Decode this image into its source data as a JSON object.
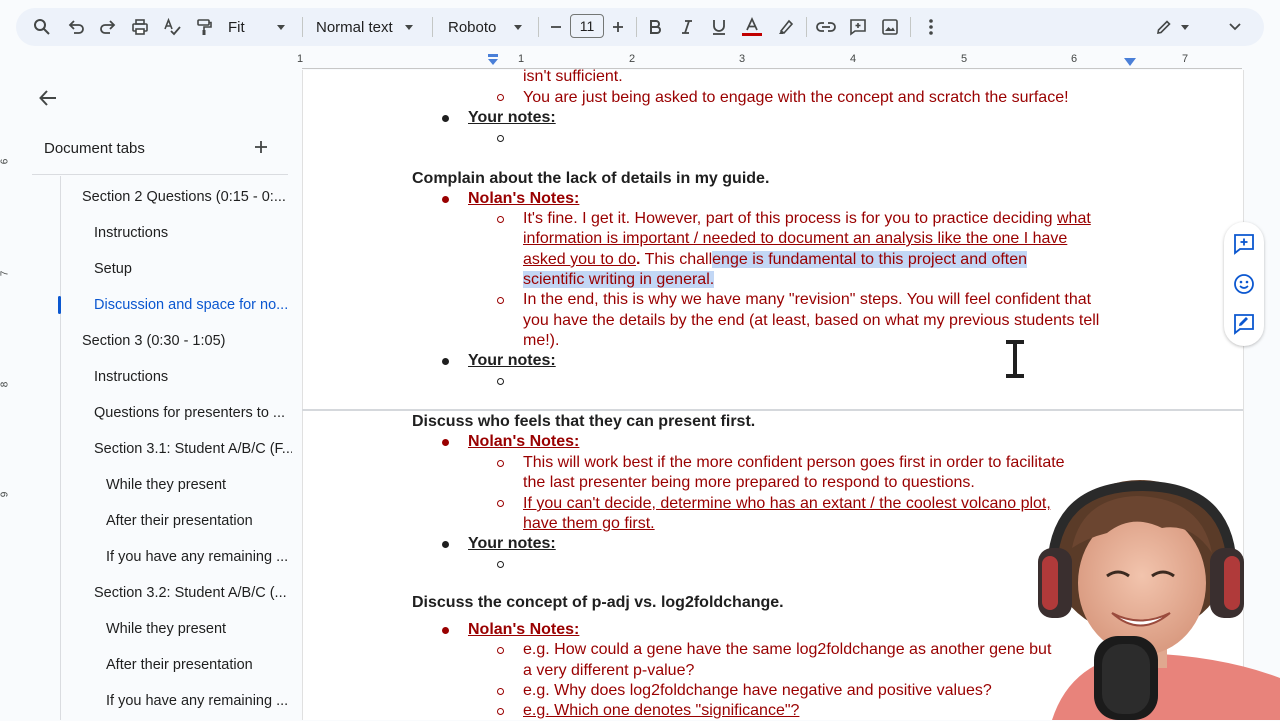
{
  "toolbar": {
    "zoom": "Fit",
    "style": "Normal text",
    "font": "Roboto",
    "font_size": "11"
  },
  "ruler": {
    "top_numbers": [
      "1",
      "1",
      "2",
      "3",
      "4",
      "5",
      "6",
      "7"
    ],
    "left_numbers": [
      "6",
      "7",
      "8",
      "9"
    ]
  },
  "sidebar": {
    "title": "Document tabs",
    "items": [
      {
        "label": "Section 2 Questions (0:15 - 0:..."
      },
      {
        "label": "Instructions"
      },
      {
        "label": "Setup"
      },
      {
        "label": "Discussion and space for no..."
      },
      {
        "label": "Section 3 (0:30 - 1:05)"
      },
      {
        "label": "Instructions"
      },
      {
        "label": "Questions for presenters to ..."
      },
      {
        "label": "Section 3.1: Student A/B/C (F..."
      },
      {
        "label": "While they present"
      },
      {
        "label": "After their presentation"
      },
      {
        "label": "If you have any remaining ..."
      },
      {
        "label": "Section 3.2: Student A/B/C (..."
      },
      {
        "label": "While they present"
      },
      {
        "label": "After their presentation"
      },
      {
        "label": "If you have any remaining ..."
      }
    ]
  },
  "doc": {
    "l01": "isn't sufficient.",
    "l02": "You are just being asked to engage with the concept and scratch the surface!",
    "your_notes": "Your notes:",
    "h1": "Complain about the lack of details in my guide.",
    "nolans_notes": "Nolan's Notes:",
    "a1": "It's fine. I get it. However, part of this process is for you to practice deciding",
    "a1u": "what",
    "a2": "information is important / needed to document an analysis like the one I have",
    "a3u": "asked you to do",
    "a3b": ".",
    "a3c": " This chall",
    "a3h": "enge is fundamental to this project and often",
    "a4h": "scientific writing in general.",
    "b1": "In the end, this is why we have many \"revision\" steps. You will feel confident that",
    "b2": "you have the details by the end (at least, based on what my previous students tell",
    "b3": "me!).",
    "h2": "Discuss who feels that they can present first.",
    "c1": "This will work best if the more confident person goes first in order to facilitate",
    "c2": "the last presenter being more prepared to respond to questions.",
    "d1": "If you can't decide, determine who has an extant / the coolest volcano plot,",
    "d2": "have them go first.",
    "h3": "Discuss the concept of p-adj vs. log2foldchange.",
    "e1": "e.g. How could a gene have the same log2foldchange as another gene but",
    "e2": "a very different p-value?",
    "f1": "e.g. Why does log2foldchange have negative and positive values?",
    "g1": "e.g. Which one denotes \"significance\"?"
  },
  "colors": {
    "accent": "#0b57d0",
    "note_red": "#990000",
    "highlight": "#c2d7f5",
    "toolbar_bg": "#edf2fa"
  }
}
